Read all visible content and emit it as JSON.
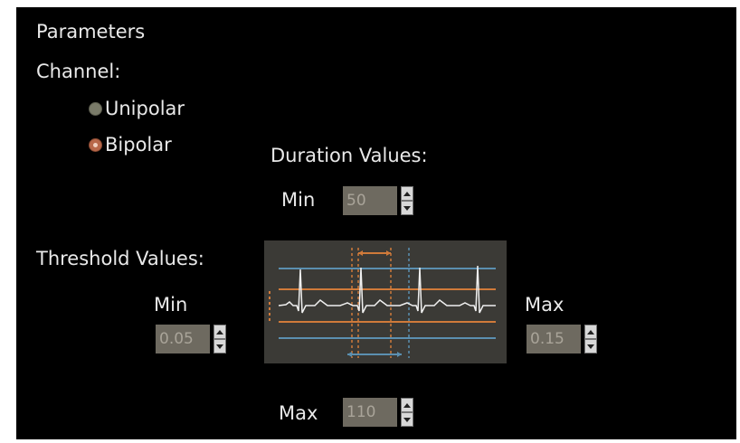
{
  "title": "Parameters",
  "channel": {
    "label": "Channel:",
    "options": [
      {
        "label": "Unipolar",
        "selected": false
      },
      {
        "label": "Bipolar",
        "selected": true
      }
    ]
  },
  "duration": {
    "label": "Duration Values:",
    "min": {
      "label": "Min",
      "value": "50"
    },
    "max": {
      "label": "Max",
      "value": "110"
    }
  },
  "threshold": {
    "label": "Threshold Values:",
    "min": {
      "label": "Min",
      "value": "0.05"
    },
    "max": {
      "label": "Max",
      "value": "0.15"
    }
  },
  "colors": {
    "background": "#000000",
    "text": "#e9e9e9",
    "spin_box": "#6e6a60",
    "spin_text": "#a9a499",
    "diagram_bg": "#3b3a36",
    "threshold_line": "#5b8fb0",
    "duration_line": "#d07a3a",
    "ecg": "#f0f0f0"
  },
  "icons": {
    "spin_up": "arrow-up-icon",
    "spin_down": "arrow-down-icon",
    "radio": "radio-icon"
  }
}
